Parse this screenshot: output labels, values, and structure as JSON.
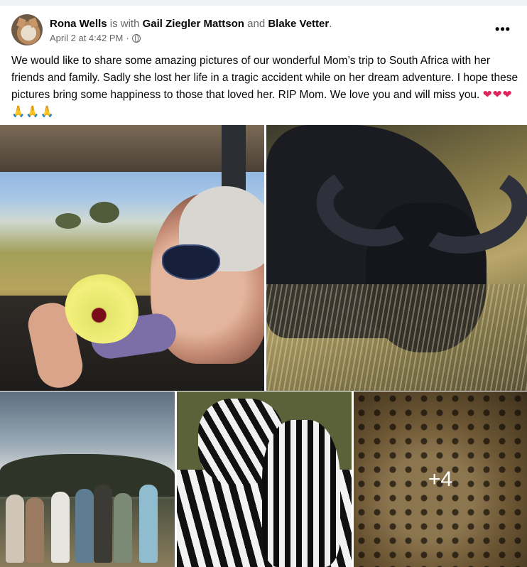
{
  "post": {
    "author": "Rona Wells",
    "with_text": "is with",
    "tagged_1": "Gail Ziegler Mattson",
    "and_text": "and",
    "tagged_2": "Blake Vetter",
    "period": ".",
    "timestamp": "April 2 at 4:42 PM",
    "separator": "·",
    "privacy_icon": "globe-icon",
    "more_label": "•••",
    "message": "We would like to share some amazing pictures of our wonderful Mom’s trip to South Africa with her friends and family. Sadly she lost her life in a tragic accident while on her dream adventure. I hope these pictures bring some happiness to those that loved her. RIP Mom. We love you and will miss you.",
    "emoji_hearts": "❤❤❤",
    "emoji_pray": "🙏🙏🙏"
  },
  "photos": {
    "extra_count": "+4"
  }
}
